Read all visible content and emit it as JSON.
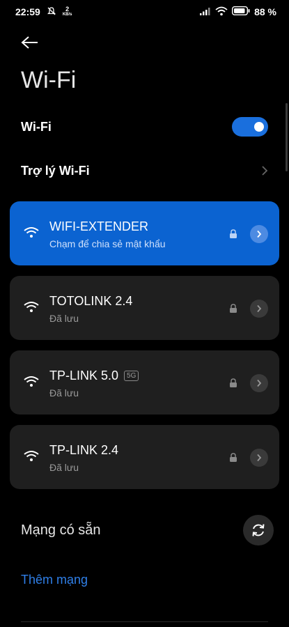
{
  "status_bar": {
    "time": "22:59",
    "net_speed_value": "2",
    "net_speed_unit": "KB/s",
    "battery_text": "88"
  },
  "page": {
    "title": "Wi-Fi"
  },
  "wifi_row": {
    "label": "Wi-Fi",
    "enabled": true
  },
  "assistant_row": {
    "label": "Trợ lý Wi-Fi"
  },
  "networks": [
    {
      "name": "WIFI-EXTENDER",
      "subtitle": "Chạm để chia sẻ mật khẩu",
      "connected": true,
      "badge": ""
    },
    {
      "name": "TOTOLINK 2.4",
      "subtitle": "Đã lưu",
      "connected": false,
      "badge": ""
    },
    {
      "name": "TP-LINK 5.0",
      "subtitle": "Đã lưu",
      "connected": false,
      "badge": "5G"
    },
    {
      "name": "TP-LINK 2.4",
      "subtitle": "Đã lưu",
      "connected": false,
      "badge": ""
    }
  ],
  "available": {
    "label": "Mạng có sẵn"
  },
  "add_network": {
    "label": "Thêm mạng"
  },
  "colors": {
    "accent": "#0b63d1",
    "link": "#2f7fe8",
    "card": "#1f1f1f"
  }
}
